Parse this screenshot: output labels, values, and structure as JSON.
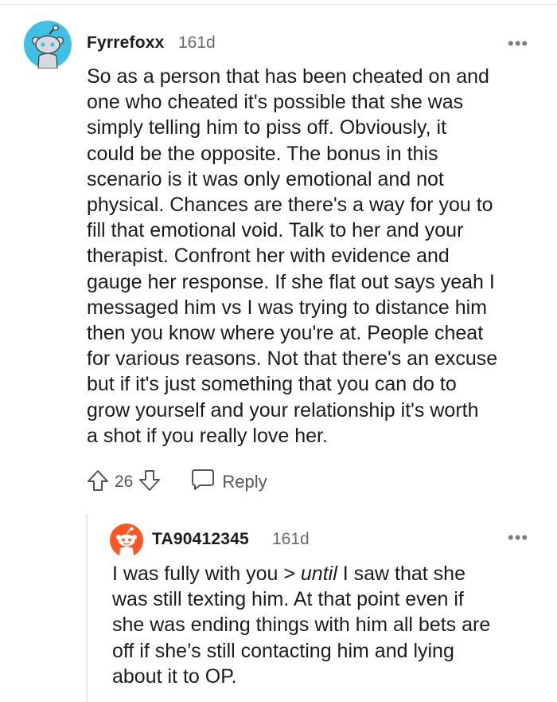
{
  "comments": [
    {
      "username": "Fyrrefoxx",
      "age": "161d",
      "more": "•••",
      "body_lines": [
        "So as a person that has been cheated on and",
        "one who cheated it's possible that she was",
        "simply telling him to piss off. Obviously, it",
        "could be the opposite. The bonus in this",
        "scenario is it was only emotional and not",
        "physical. Chances are there's a way for you to",
        "fill that emotional void. Talk to her and your",
        "therapist. Confront her with evidence and",
        "gauge her response. If she flat out says yeah I",
        "messaged him vs I was trying to distance him",
        "then you know where you're at. People cheat",
        "for various reasons. Not that there's an excuse",
        "but if it's just something that you can do to",
        "grow yourself and your relationship it's worth",
        "a shot if you really love her."
      ],
      "votes": "26",
      "reply_label": "Reply"
    },
    {
      "username": "TA90412345",
      "age": "161d",
      "more": "•••",
      "body": {
        "l1_before": "I was fully with you > ",
        "l1_italic": "until",
        "l1_after": " I saw that she",
        "lines": [
          "was still texting him. At that point even if",
          "she was ending things with him all bets are",
          "off if she’s still contacting him and lying",
          "about it to OP."
        ]
      }
    }
  ],
  "colors": {
    "avatar1_bg": "#3fc1e3",
    "avatar2_bg": "#ff5722",
    "text": "#1c1c1c",
    "muted": "#6a6a6a"
  },
  "icons": [
    "reddit-snoo-avatar-icon",
    "upvote-arrow-icon",
    "downvote-arrow-icon",
    "speech-bubble-icon",
    "more-options-icon"
  ]
}
